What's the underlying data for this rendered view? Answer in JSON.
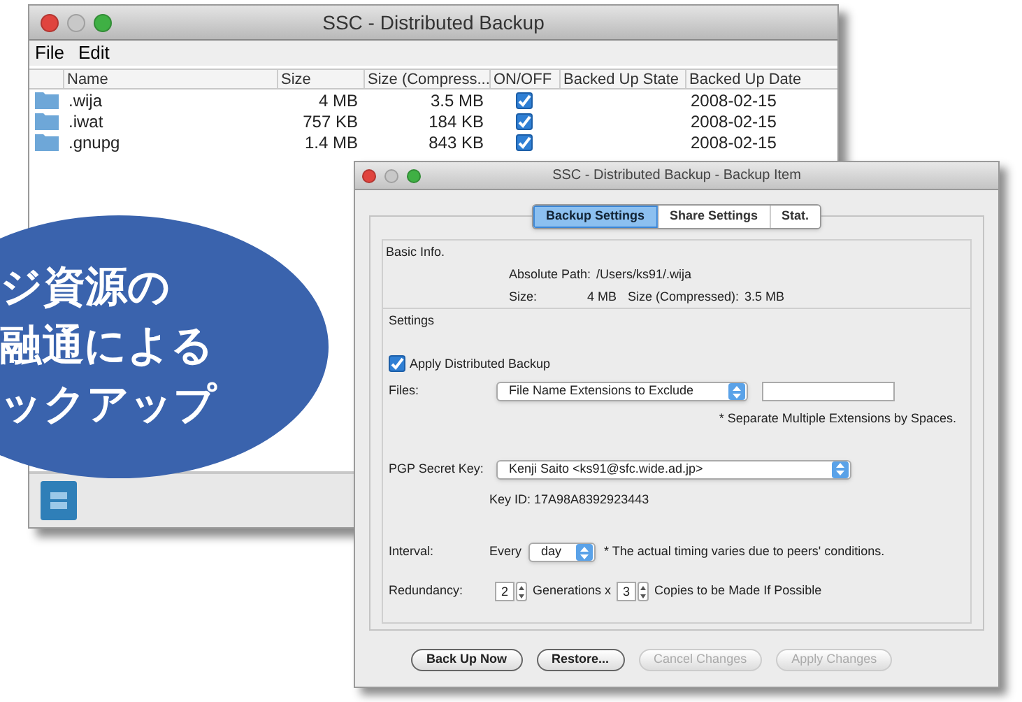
{
  "main_window": {
    "title": "SSC - Distributed Backup",
    "menu": [
      "File",
      "Edit"
    ],
    "table": {
      "columns": [
        "Name",
        "Size",
        "Size (Compress...",
        "ON/OFF",
        "Backed Up State",
        "Backed Up Date"
      ],
      "rows": [
        {
          "name": ".wija",
          "size": "4 MB",
          "size_compressed": "3.5 MB",
          "on": true,
          "date": "2008-02-15"
        },
        {
          "name": ".iwat",
          "size": "757 KB",
          "size_compressed": "184 KB",
          "on": true,
          "date": "2008-02-15"
        },
        {
          "name": ".gnupg",
          "size": "1.4 MB",
          "size_compressed": "843 KB",
          "on": true,
          "date": "2008-02-15"
        }
      ]
    }
  },
  "callout": {
    "lines": [
      "ジ資源の",
      "融通による",
      "ックアップ"
    ]
  },
  "item_window": {
    "title": "SSC - Distributed Backup - Backup Item",
    "tabs": [
      {
        "label": "Backup Settings",
        "selected": true
      },
      {
        "label": "Share Settings",
        "selected": false
      },
      {
        "label": "Stat.",
        "selected": false
      }
    ],
    "basic_info": {
      "title": "Basic Info.",
      "path_label": "Absolute Path:",
      "path": "/Users/ks91/.wija",
      "size_label": "Size:",
      "size": "4 MB",
      "compressed_label": "Size (Compressed):",
      "compressed": "3.5 MB"
    },
    "settings": {
      "title": "Settings",
      "apply": {
        "label": "Apply Distributed Backup",
        "checked": true
      },
      "files_label": "Files:",
      "files_select": "File Name Extensions to Exclude",
      "files_note": "* Separate Multiple Extensions by Spaces.",
      "key_label": "PGP Secret Key:",
      "key_select": "Kenji Saito <ks91@sfc.wide.ad.jp>",
      "key_id": "Key ID: 17A98A8392923443",
      "interval_label": "Interval:",
      "interval_every": "Every",
      "interval_select": "day",
      "interval_note": "* The actual timing varies due to peers' conditions.",
      "redundancy_label": "Redundancy:",
      "generations": "2",
      "generations_text": "Generations x",
      "copies": "3",
      "copies_text": "Copies to be Made If Possible"
    },
    "buttons": [
      {
        "label": "Back Up Now",
        "disabled": false
      },
      {
        "label": "Restore...",
        "disabled": false
      },
      {
        "label": "Cancel Changes",
        "disabled": true
      },
      {
        "label": "Apply Changes",
        "disabled": true
      }
    ]
  }
}
